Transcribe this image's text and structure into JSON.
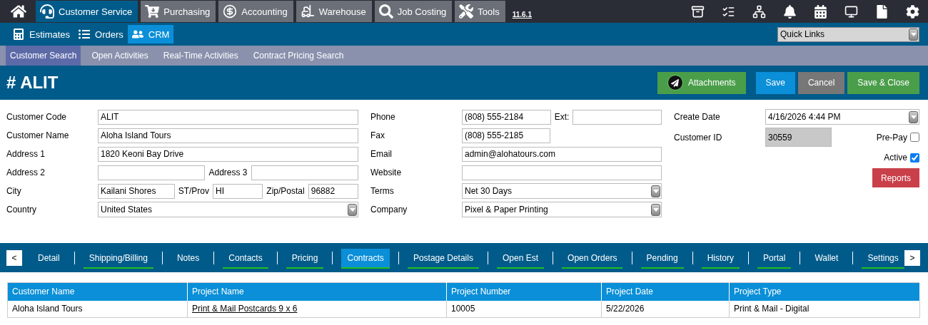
{
  "top_nav": {
    "modules": [
      {
        "label": "Customer Service",
        "selected": true
      },
      {
        "label": "Purchasing",
        "selected": false
      },
      {
        "label": "Accounting",
        "selected": false
      },
      {
        "label": "Warehouse",
        "selected": false
      },
      {
        "label": "Job Costing",
        "selected": false
      },
      {
        "label": "Tools",
        "selected": false
      }
    ],
    "version": "11.6.1"
  },
  "sub_nav": {
    "items": [
      {
        "label": "Estimates",
        "selected": false
      },
      {
        "label": "Orders",
        "selected": false
      },
      {
        "label": "CRM",
        "selected": true
      }
    ],
    "quick_links": "Quick Links"
  },
  "section_nav": [
    {
      "label": "Customer Search",
      "selected": true
    },
    {
      "label": "Open Activities",
      "selected": false
    },
    {
      "label": "Real-Time Activities",
      "selected": false
    },
    {
      "label": "Contract Pricing Search",
      "selected": false
    }
  ],
  "header": {
    "title": "# ALIT",
    "buttons": [
      {
        "label": "Attachments",
        "kind": "attachments"
      },
      {
        "label": "Save",
        "kind": "primary"
      },
      {
        "label": "Cancel",
        "kind": "secondary"
      },
      {
        "label": "Save & Close",
        "kind": "success"
      }
    ]
  },
  "form": {
    "column_1": [
      {
        "label": "Customer Code",
        "fields": [
          {
            "kind": "input",
            "value": "ALIT"
          }
        ]
      },
      {
        "label": "Customer Name",
        "fields": [
          {
            "kind": "input",
            "value": "Aloha Island Tours"
          }
        ]
      },
      {
        "label": "Address 1",
        "fields": [
          {
            "kind": "input",
            "value": "1820 Keoni Bay Drive"
          }
        ]
      },
      {
        "label": "Address 2",
        "fields": [
          {
            "kind": "input"
          },
          {
            "kind": "label",
            "text": "Address 3"
          },
          {
            "kind": "input"
          }
        ]
      },
      {
        "label": "City",
        "fields": [
          {
            "kind": "input",
            "value": "Kailani Shores"
          },
          {
            "kind": "label",
            "text": "ST/Prov"
          },
          {
            "kind": "input",
            "value": "HI"
          },
          {
            "kind": "label",
            "text": "Zip/Postal"
          },
          {
            "kind": "input",
            "value": "96882"
          }
        ]
      },
      {
        "label": "Country",
        "fields": [
          {
            "kind": "select",
            "value": "United States"
          }
        ]
      }
    ],
    "column_2": [
      {
        "label": "Phone",
        "fields": [
          {
            "kind": "input",
            "value": "(808) 555-2184"
          },
          {
            "kind": "label",
            "text": "Ext:"
          },
          {
            "kind": "input"
          }
        ]
      },
      {
        "label": "Fax",
        "fields": [
          {
            "kind": "input_short",
            "value": "(808) 555-2185"
          }
        ]
      },
      {
        "label": "Email",
        "fields": [
          {
            "kind": "input",
            "value": "admin@alohatours.com"
          }
        ]
      },
      {
        "label": "Website",
        "fields": [
          {
            "kind": "input"
          }
        ]
      },
      {
        "label": "Terms",
        "fields": [
          {
            "kind": "select",
            "value": "Net 30 Days"
          }
        ]
      },
      {
        "label": "Company",
        "fields": [
          {
            "kind": "select",
            "value": "Pixel & Paper Printing"
          }
        ]
      }
    ],
    "column_3": {
      "create_date": {
        "label": "Create Date",
        "value": "4/16/2026 4:44 PM"
      },
      "customer_id": {
        "label": "Customer ID",
        "value": "30559"
      },
      "pre_pay": {
        "label": "Pre-Pay",
        "checked": false
      },
      "active": {
        "label": "Active",
        "checked": true
      },
      "reports_button": "Reports"
    }
  },
  "detail_tabs": {
    "prev": "<",
    "next": ">",
    "tabs": [
      {
        "label": "Detail",
        "selected": false,
        "underlined": false
      },
      {
        "label": "Shipping/Billing",
        "selected": false,
        "underlined": true
      },
      {
        "label": "Notes",
        "selected": false,
        "underlined": false
      },
      {
        "label": "Contacts",
        "selected": false,
        "underlined": true
      },
      {
        "label": "Pricing",
        "selected": false,
        "underlined": true
      },
      {
        "label": "Contracts",
        "selected": true,
        "underlined": true
      },
      {
        "label": "Postage Details",
        "selected": false,
        "underlined": true
      },
      {
        "label": "Open Est",
        "selected": false,
        "underlined": true
      },
      {
        "label": "Open Orders",
        "selected": false,
        "underlined": true
      },
      {
        "label": "Pending",
        "selected": false,
        "underlined": true
      },
      {
        "label": "History",
        "selected": false,
        "underlined": true
      },
      {
        "label": "Portal",
        "selected": false,
        "underlined": true
      },
      {
        "label": "Wallet",
        "selected": false,
        "underlined": false
      },
      {
        "label": "Settings",
        "selected": false,
        "underlined": true
      }
    ]
  },
  "table": {
    "columns": [
      {
        "label": "Customer Name",
        "link": false
      },
      {
        "label": "Project Name",
        "link": true
      },
      {
        "label": "Project Number",
        "link": false
      },
      {
        "label": "Project Date",
        "link": false
      },
      {
        "label": "Project Type",
        "link": false
      }
    ],
    "rows": [
      {
        "cells": [
          "Aloha Island Tours",
          "Print & Mail Postcards 9 x 6",
          "10005",
          "5/22/2026",
          "Print & Mail - Digital"
        ]
      }
    ]
  }
}
